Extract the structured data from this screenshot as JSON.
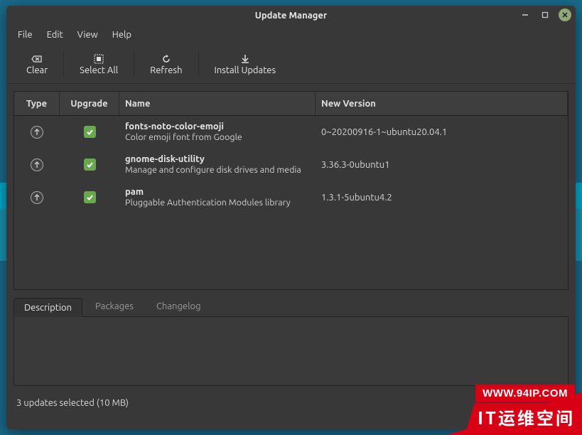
{
  "window": {
    "title": "Update Manager"
  },
  "menu": {
    "file": "File",
    "edit": "Edit",
    "view": "View",
    "help": "Help"
  },
  "toolbar": {
    "clear": "Clear",
    "select_all": "Select All",
    "refresh": "Refresh",
    "install": "Install Updates"
  },
  "columns": {
    "type": "Type",
    "upgrade": "Upgrade",
    "name": "Name",
    "new_version": "New Version"
  },
  "updates": [
    {
      "name": "fonts-noto-color-emoji",
      "desc": "Color emoji font from Google",
      "version": "0~20200916-1~ubuntu20.04.1",
      "checked": true
    },
    {
      "name": "gnome-disk-utility",
      "desc": "Manage and configure disk drives and media",
      "version": "3.36.3-0ubuntu1",
      "checked": true
    },
    {
      "name": "pam",
      "desc": "Pluggable Authentication Modules library",
      "version": "1.3.1-5ubuntu4.2",
      "checked": true
    }
  ],
  "tabs": {
    "description": "Description",
    "packages": "Packages",
    "changelog": "Changelog"
  },
  "status": "3 updates selected (10 MB)",
  "watermark": {
    "line1": "WWW.94IP.COM",
    "line2": "IT运维空间"
  }
}
